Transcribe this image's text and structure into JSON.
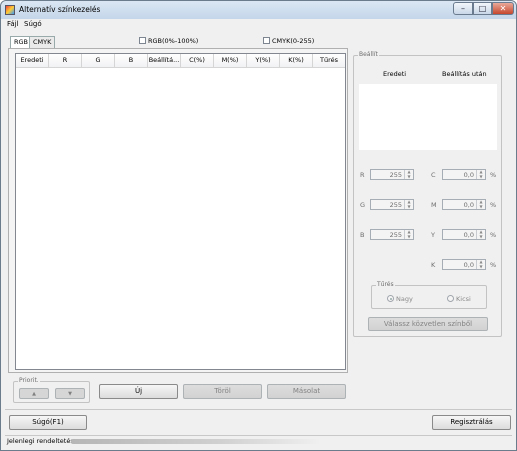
{
  "window": {
    "title": "Alternatív színkezelés"
  },
  "titlebar_buttons": {
    "minimize_glyph": "–",
    "maximize_glyph": "□",
    "close_glyph": "✕"
  },
  "menu": [
    "Fájl",
    "Súgó"
  ],
  "tabs": [
    "RGB",
    "CMYK"
  ],
  "checkboxes": {
    "rgb_percent": "RGB(0%-100%)",
    "cmyk_range": "CMYK(0-255)"
  },
  "table": {
    "columns": [
      "Eredeti",
      "R",
      "G",
      "B",
      "Beállítá...",
      "C(%)",
      "M(%)",
      "Y(%)",
      "K(%)",
      "Tűrés"
    ],
    "rows": []
  },
  "settings": {
    "legend": "Beállít",
    "col_original": "Eredeti",
    "col_after": "Beállítás után",
    "fields": {
      "R": "255",
      "G": "255",
      "B": "255",
      "C": "0,0",
      "M": "0,0",
      "Y": "0,0",
      "K": "0,0"
    },
    "unit": "%",
    "tolerance": {
      "legend": "Tűrés",
      "options": [
        "Nagy",
        "Kicsi"
      ],
      "selected": "Nagy"
    },
    "select_button": "Válassz közvetlen színből"
  },
  "priority": {
    "legend": "Priorit.",
    "up_glyph": "▲",
    "down_glyph": "▼"
  },
  "buttons": {
    "new": "Új",
    "delete": "Töröl",
    "copy": "Másolat",
    "help": "Súgó(F1)",
    "register": "Regisztrálás"
  },
  "status": {
    "text": "Jelenlegi rendeltetés"
  }
}
